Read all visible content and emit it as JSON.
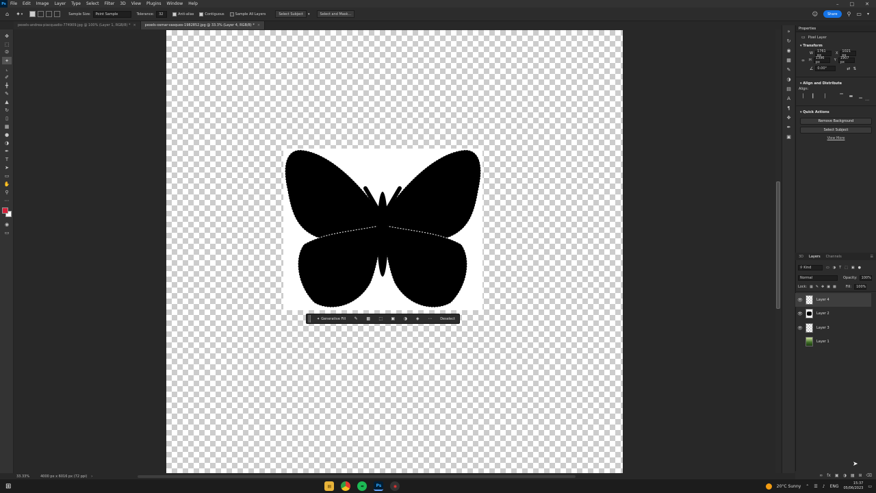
{
  "menubar": {
    "app_icon": "Ps",
    "items": [
      "File",
      "Edit",
      "Image",
      "Layer",
      "Type",
      "Select",
      "Filter",
      "3D",
      "View",
      "Plugins",
      "Window",
      "Help"
    ]
  },
  "options": {
    "sample_size_label": "Sample Size:",
    "sample_size_value": "Point Sample",
    "tolerance_label": "Tolerance:",
    "tolerance_value": "32",
    "anti_alias": "Anti-alias",
    "contiguous": "Contiguous",
    "sample_all_layers": "Sample All Layers",
    "select_subject": "Select Subject",
    "select_and_mask": "Select and Mask...",
    "share": "Share"
  },
  "tabs": [
    {
      "label": "pexels-andrea-piacquadio-774909.jpg @ 100% (Layer 1, RGB/8) *"
    },
    {
      "label": "pexels-osmar-vasques-1982852.jpg @ 33.3% (Layer 4, RGB/8) *"
    }
  ],
  "contextbar": {
    "generative_fill": "Generative Fill",
    "deselect": "Deselect"
  },
  "properties": {
    "title": "Properties",
    "layer_type": "Pixel Layer",
    "transform_title": "Transform",
    "w_label": "W",
    "w_value": "1761 px",
    "x_label": "X",
    "x_value": "1021 px",
    "h_label": "H",
    "h_value": "1396 px",
    "y_label": "Y",
    "y_value": "1907 px",
    "angle_value": "0.00°",
    "align_title": "Align and Distribute",
    "align_label": "Align:",
    "quick_actions_title": "Quick Actions",
    "remove_background": "Remove Background",
    "select_subject": "Select Subject",
    "view_more": "View More"
  },
  "layers_panel": {
    "tabs": [
      "3D",
      "Layers",
      "Channels"
    ],
    "kind": "Kind",
    "blend_mode": "Normal",
    "opacity_label": "Opacity:",
    "opacity_value": "100%",
    "lock_label": "Lock:",
    "fill_label": "Fill:",
    "fill_value": "100%",
    "layers": [
      {
        "name": "Layer 4",
        "visible": true,
        "active": true
      },
      {
        "name": "Layer 2",
        "visible": true,
        "active": false
      },
      {
        "name": "Layer 3",
        "visible": true,
        "active": false
      },
      {
        "name": "Layer 1",
        "visible": false,
        "active": false
      }
    ]
  },
  "status": {
    "zoom": "33.33%",
    "doc_size": "4000 px x 6016 px (72 ppi)"
  },
  "taskbar": {
    "weather": "20°C  Sunny",
    "lang": "ENG",
    "time": "15:37",
    "date": "05/06/2023"
  }
}
